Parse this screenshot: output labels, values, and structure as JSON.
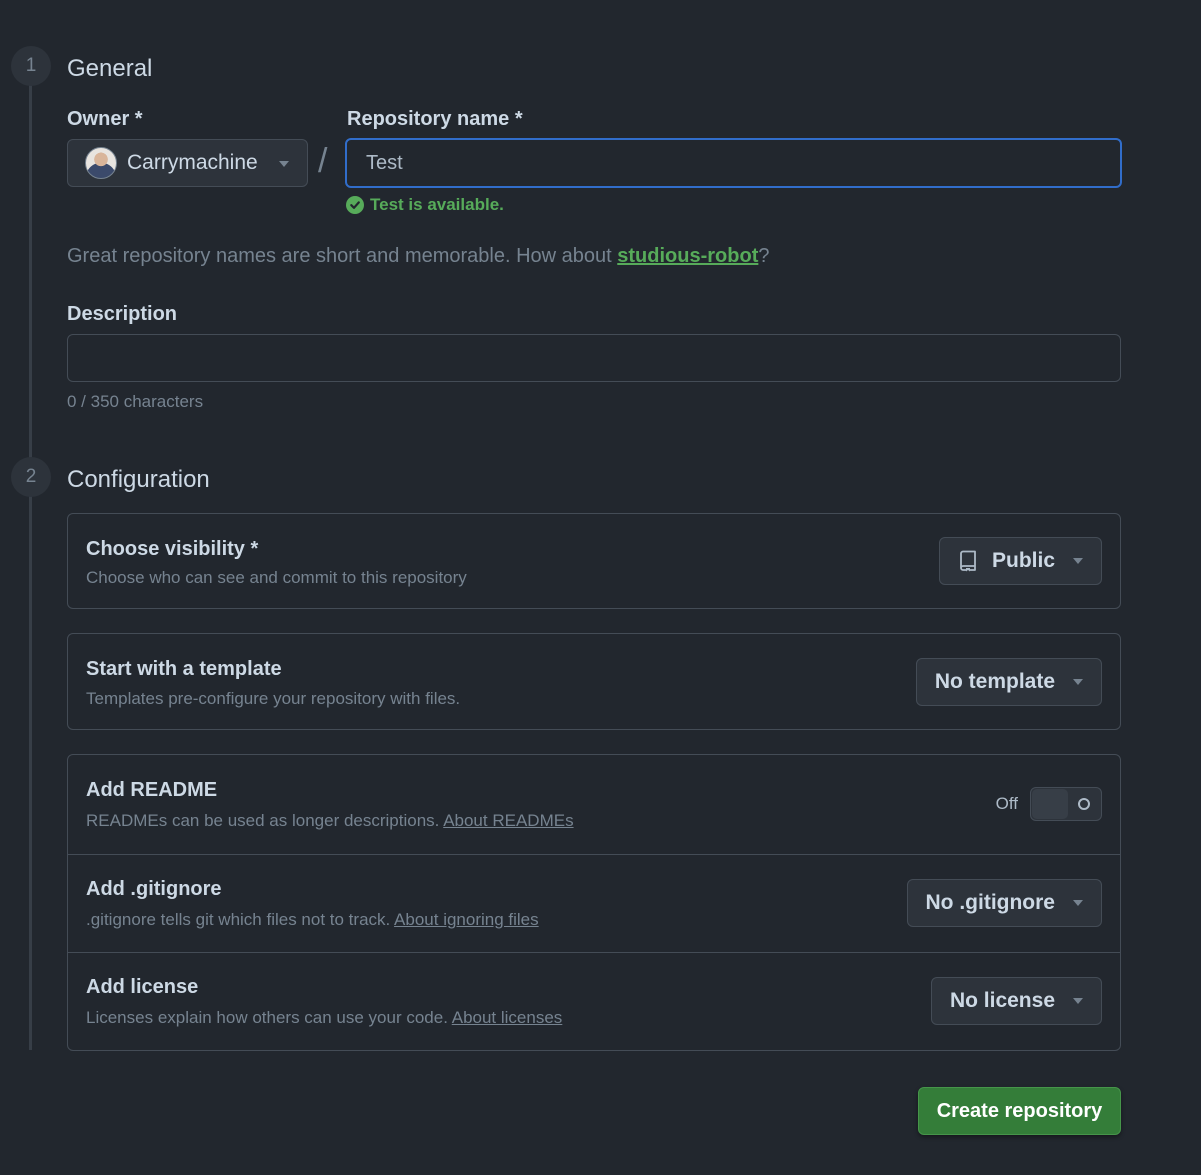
{
  "steps": [
    {
      "number": "1",
      "title": "General"
    },
    {
      "number": "2",
      "title": "Configuration"
    }
  ],
  "general": {
    "owner_label": "Owner *",
    "owner_name": "Carrymachine",
    "separator": "/",
    "repo_label": "Repository name *",
    "repo_value": "Test",
    "availability": "Test is available.",
    "hint_prefix": "Great repository names are short and memorable. How about ",
    "hint_suggestion": "studious-robot",
    "hint_suffix": "?",
    "description_label": "Description",
    "description_value": "",
    "description_counter": "0 / 350 characters"
  },
  "configuration": {
    "visibility": {
      "title": "Choose visibility *",
      "description": "Choose who can see and commit to this repository",
      "value": "Public",
      "icon": "repo-icon"
    },
    "template": {
      "title": "Start with a template",
      "description": "Templates pre-configure your repository with files.",
      "value": "No template"
    },
    "readme": {
      "title": "Add README",
      "description": "READMEs can be used as longer descriptions. ",
      "link": "About READMEs",
      "toggle_label": "Off",
      "toggle_state": false
    },
    "gitignore": {
      "title": "Add .gitignore",
      "description": ".gitignore tells git which files not to track. ",
      "link": "About ignoring files",
      "value": "No .gitignore"
    },
    "license": {
      "title": "Add license",
      "description": "Licenses explain how others can use your code. ",
      "link": "About licenses",
      "value": "No license"
    }
  },
  "actions": {
    "create_label": "Create repository"
  },
  "colors": {
    "background": "#22272e",
    "accent_green": "#57ab5a",
    "focus_blue": "#316dca",
    "button_green": "#347d39"
  }
}
